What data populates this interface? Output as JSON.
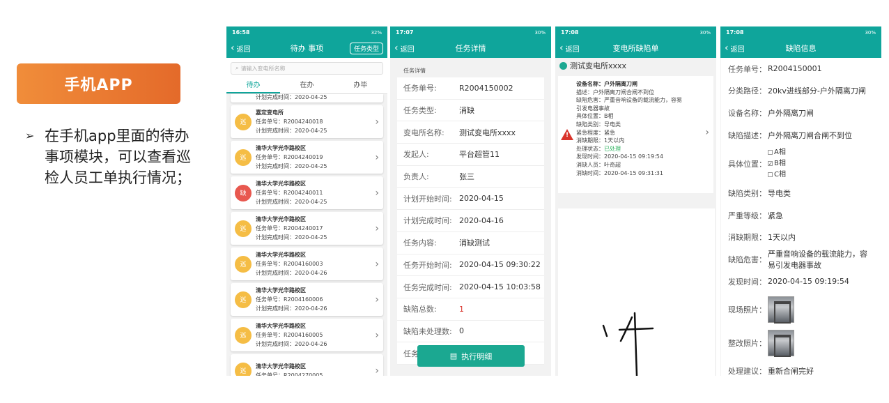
{
  "badge": "手机APP",
  "bullet": {
    "arrow": "➢",
    "text": "在手机app里面的待办事项模块，可以查看巡检人员工单执行情况；"
  },
  "phone1": {
    "status_left": "16:58",
    "status_right": "32%",
    "back": "返回",
    "title": "待办 事项",
    "type_button": "任务类型",
    "search_placeholder": "请输入变电所名称",
    "tabs": [
      "待办",
      "在办",
      "办毕"
    ],
    "partial_text": "计划完成时间：2020-04-25",
    "items": [
      {
        "icon": "巡",
        "name": "嘉定变电所",
        "order": "任务单号：R2004240018",
        "time": "计划完成时间：2020-04-25"
      },
      {
        "icon": "巡",
        "name": "清华大学光华路校区",
        "order": "任务单号：R2004240019",
        "time": "计划完成时间：2020-04-25"
      },
      {
        "icon": "缺",
        "name": "清华大学光华路校区",
        "order": "任务单号：R2004240011",
        "time": "计划完成时间：2020-04-25"
      },
      {
        "icon": "巡",
        "name": "清华大学光华路校区",
        "order": "任务单号：R2004240017",
        "time": "计划完成时间：2020-04-25"
      },
      {
        "icon": "巡",
        "name": "清华大学光华路校区",
        "order": "任务单号：R2004160003",
        "time": "计划完成时间：2020-04-26"
      },
      {
        "icon": "巡",
        "name": "清华大学光华路校区",
        "order": "任务单号：R2004160006",
        "time": "计划完成时间：2020-04-26"
      },
      {
        "icon": "巡",
        "name": "清华大学光华路校区",
        "order": "任务单号：R2004160005",
        "time": "计划完成时间：2020-04-26"
      },
      {
        "icon": "巡",
        "name": "清华大学光华路校区",
        "order": "任务单号：R2004270005",
        "time": ""
      }
    ]
  },
  "phone2": {
    "status_left": "17:07",
    "status_right": "30%",
    "back": "返回",
    "title": "任务详情",
    "section": "任务详情",
    "rows": [
      {
        "k": "任务单号:",
        "v": "R2004150002"
      },
      {
        "k": "任务类型:",
        "v": "消缺"
      },
      {
        "k": "变电所名称:",
        "v": "测试变电所xxxx"
      },
      {
        "k": "发起人:",
        "v": "平台超管11"
      },
      {
        "k": "负责人:",
        "v": "张三"
      },
      {
        "k": "计划开始时间:",
        "v": "2020-04-15"
      },
      {
        "k": "计划完成时间:",
        "v": "2020-04-16"
      },
      {
        "k": "任务内容:",
        "v": "消缺测试"
      },
      {
        "k": "任务开始时间:",
        "v": "2020-04-15 09:30:22"
      },
      {
        "k": "任务完成时间:",
        "v": "2020-04-15 10:03:58"
      },
      {
        "k": "缺陷总数:",
        "v": "1"
      },
      {
        "k": "缺陷未处理数:",
        "v": "0"
      },
      {
        "k": "任务",
        "v": ""
      }
    ],
    "exec_button": "执行明细"
  },
  "phone3": {
    "status_left": "17:08",
    "status_right": "30%",
    "back": "返回",
    "title": "变电所缺陷单",
    "station": "测试变电所xxxx",
    "defect_name": "设备名称：户外隔离刀闸",
    "lines": [
      "描述：户外隔离刀闸合闸不到位",
      "缺陷危害：严重音响设备的载流能力，容易",
      "引发电器事故",
      "具体位置：B相",
      "缺陷类别：导电类",
      "紧急程度：紧急",
      "消缺期限：1天以内"
    ],
    "status_label": "处理状态：",
    "status_value": "已处理",
    "lines2": [
      "发现时间：2020-04-15 09:19:54",
      "消缺人员：叶奇超",
      "消缺时间：2020-04-15 09:31:31"
    ]
  },
  "phone4": {
    "status_left": "17:08",
    "status_right": "30%",
    "back": "返回",
    "title": "缺陷信息",
    "rows": [
      {
        "k": "任务单号：",
        "v": "R2004150001"
      },
      {
        "k": "分类路径：",
        "v": "20kv进线部分-户外隔离刀闸"
      },
      {
        "k": "设备名称：",
        "v": "户外隔离刀闸"
      },
      {
        "k": "缺陷描述：",
        "v": "户外隔离刀闸合闸不到位"
      }
    ],
    "position_label": "具体位置：",
    "position_options": [
      "A相",
      "B相",
      "C相"
    ],
    "rows2": [
      {
        "k": "缺陷类别：",
        "v": "导电类"
      },
      {
        "k": "严重等级：",
        "v": "紧急"
      },
      {
        "k": "消缺期限：",
        "v": "1天以内"
      },
      {
        "k": "缺陷危害：",
        "v": "严重音响设备的载流能力，容易引发电器事故"
      },
      {
        "k": "发现时间：",
        "v": "2020-04-15 09:19:54"
      }
    ],
    "photo1_label": "现场照片：",
    "photo2_label": "整改照片：",
    "suggest_label": "处理建议：",
    "suggest_value": "重新合闸完好"
  }
}
